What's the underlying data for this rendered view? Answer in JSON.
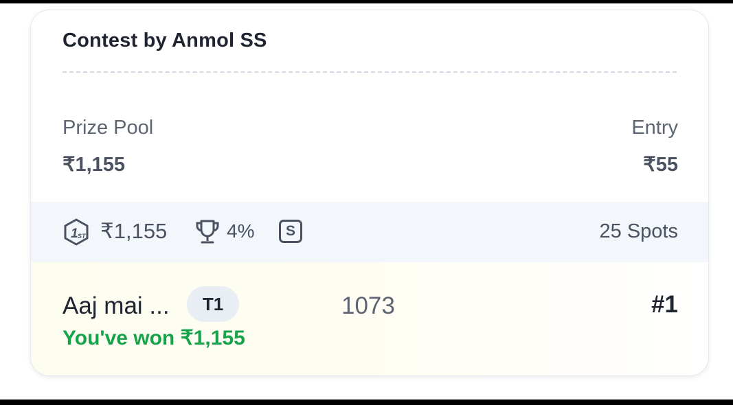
{
  "contest": {
    "title": "Contest by Anmol SS"
  },
  "prize_pool": {
    "label": "Prize Pool",
    "amount": "₹1,155"
  },
  "entry": {
    "label": "Entry",
    "amount": "₹55"
  },
  "info": {
    "first_prize_icon": "first-place-icon",
    "first_prize": "₹1,155",
    "winners_icon": "trophy-icon",
    "winners_percent": "4%",
    "single_entry_badge": "S",
    "spots": "25 Spots"
  },
  "team": {
    "name": "Aaj mai ...",
    "badge": "T1",
    "points": "1073",
    "rank": "#1",
    "result": "You've won ₹1,155"
  },
  "colors": {
    "won_green": "#17a34a",
    "strip_bg": "#f3f7fb",
    "text_dark": "#1f2430",
    "text_muted": "#4a5261"
  }
}
